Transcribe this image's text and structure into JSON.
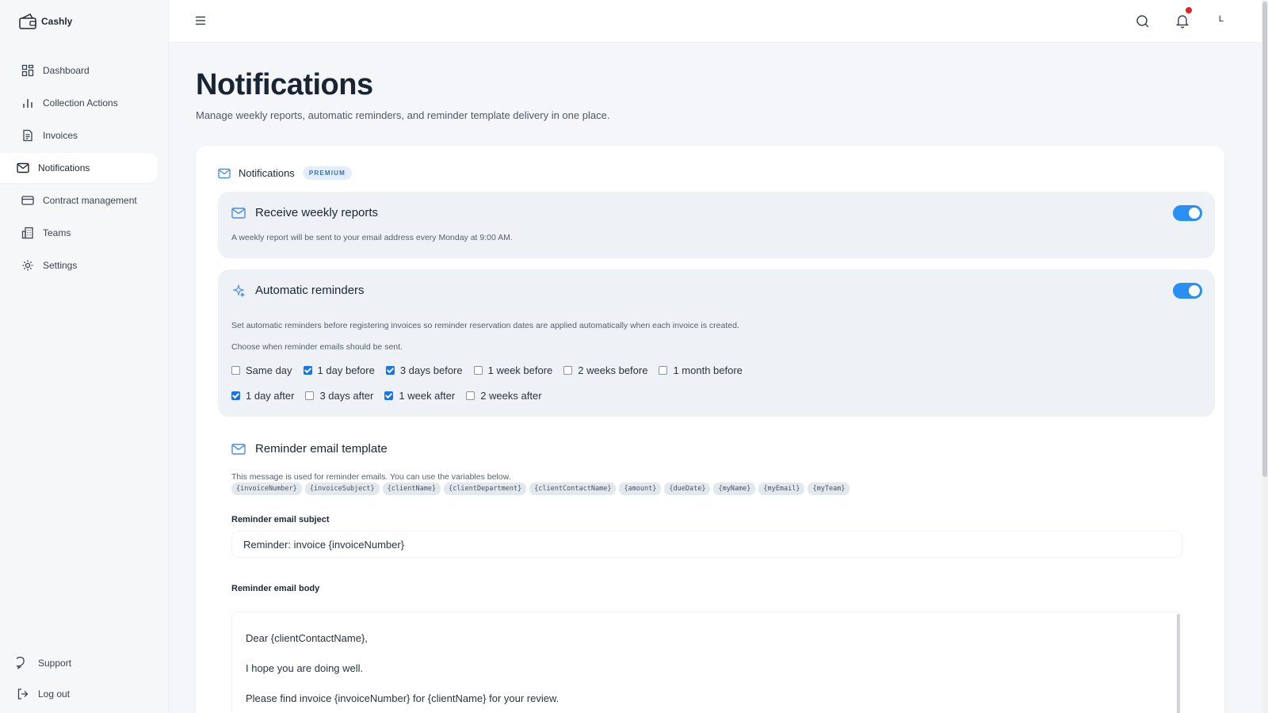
{
  "app": {
    "name": "Cashly"
  },
  "sidebar": {
    "items": [
      {
        "label": "Dashboard",
        "icon": "grid-icon"
      },
      {
        "label": "Collection Actions",
        "icon": "bar-chart-icon"
      },
      {
        "label": "Invoices",
        "icon": "document-icon"
      },
      {
        "label": "Notifications",
        "icon": "mail-icon",
        "active": true
      },
      {
        "label": "Contract management",
        "icon": "card-icon"
      },
      {
        "label": "Teams",
        "icon": "building-icon"
      },
      {
        "label": "Settings",
        "icon": "gear-icon"
      }
    ],
    "bottom": [
      {
        "label": "Support",
        "icon": "chat-icon"
      },
      {
        "label": "Log out",
        "icon": "logout-icon"
      }
    ]
  },
  "topbar": {
    "avatar_initial": "L",
    "has_unread": true
  },
  "page": {
    "title": "Notifications",
    "subtitle": "Manage weekly reports, automatic reminders, and reminder template delivery in one place."
  },
  "card": {
    "title": "Notifications",
    "badge": "PREMIUM"
  },
  "weekly": {
    "title": "Receive weekly reports",
    "description": "A weekly report will be sent to your email address every Monday at 9:00 AM.",
    "enabled": true
  },
  "reminders": {
    "title": "Automatic reminders",
    "description": "Set automatic reminders before registering invoices so reminder reservation dates are applied automatically when each invoice is created.",
    "choose_text": "Choose when reminder emails should be sent.",
    "enabled": true,
    "before": [
      {
        "label": "Same day",
        "checked": false
      },
      {
        "label": "1 day before",
        "checked": true
      },
      {
        "label": "3 days before",
        "checked": true
      },
      {
        "label": "1 week before",
        "checked": false
      },
      {
        "label": "2 weeks before",
        "checked": false
      },
      {
        "label": "1 month before",
        "checked": false
      }
    ],
    "after": [
      {
        "label": "1 day after",
        "checked": true
      },
      {
        "label": "3 days after",
        "checked": false
      },
      {
        "label": "1 week after",
        "checked": true
      },
      {
        "label": "2 weeks after",
        "checked": false
      }
    ]
  },
  "template": {
    "title": "Reminder email template",
    "description": "This message is used for reminder emails. You can use the variables below.",
    "variables": [
      "{invoiceNumber}",
      "{invoiceSubject}",
      "{clientName}",
      "{clientDepartment}",
      "{clientContactName}",
      "{amount}",
      "{dueDate}",
      "{myName}",
      "{myEmail}",
      "{myTeam}"
    ],
    "subject_label": "Reminder email subject",
    "subject_value": "Reminder: invoice {invoiceNumber}",
    "body_label": "Reminder email body",
    "body_lines": [
      "Dear {clientContactName},",
      "I hope you are doing well.",
      "Please find invoice {invoiceNumber} for {clientName} for your review."
    ]
  },
  "colors": {
    "accent": "#2a8ff2",
    "icon_blue": "#4a90e2",
    "bell_dot": "#e02424"
  }
}
